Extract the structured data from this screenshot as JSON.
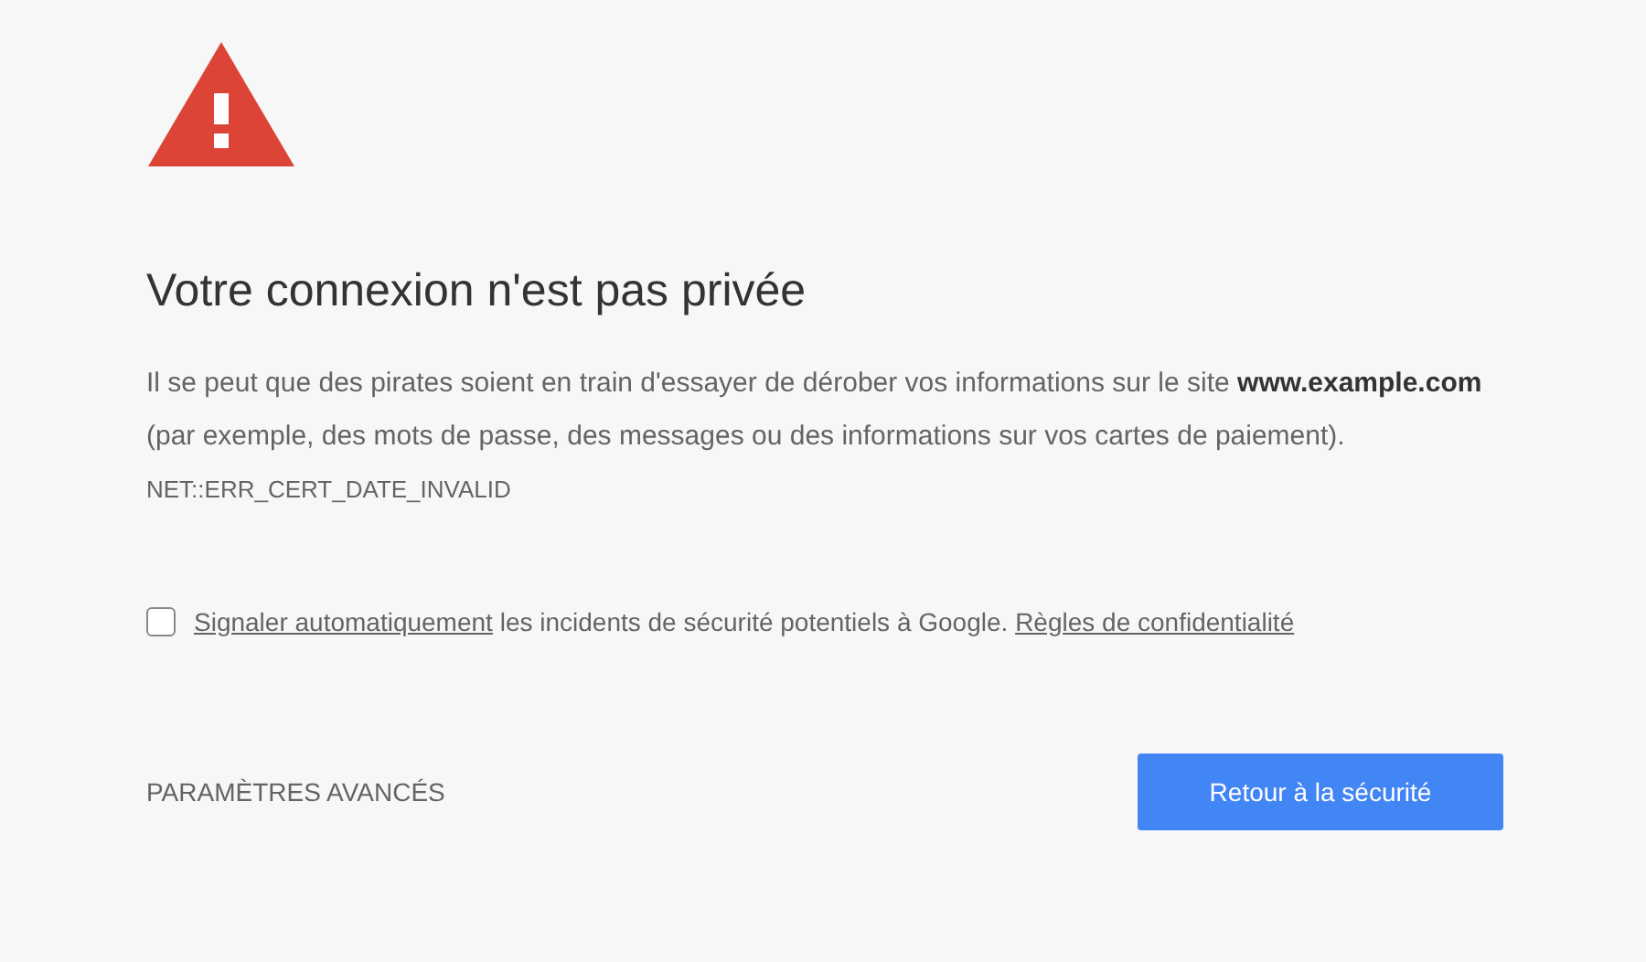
{
  "heading": "Votre connexion n'est pas privée",
  "description": "Il se peut que des pirates soient en train d'essayer de dérober vos informations sur le site **www.example.com** (par exemple, des mots de passe, des messages ou des informations sur vos cartes de paiement).",
  "error_code": "NET::ERR_CERT_DATE_INVALID",
  "report": {
    "checked": false,
    "link": "Signaler automatiquement",
    "text": "les incidents de sécurité potentiels à Google.",
    "privacy_link": "Règles de confidentialité"
  },
  "advanced_button": "PARAMÈTRES AVANCÉS",
  "back_button": "Retour à la sécurité"
}
